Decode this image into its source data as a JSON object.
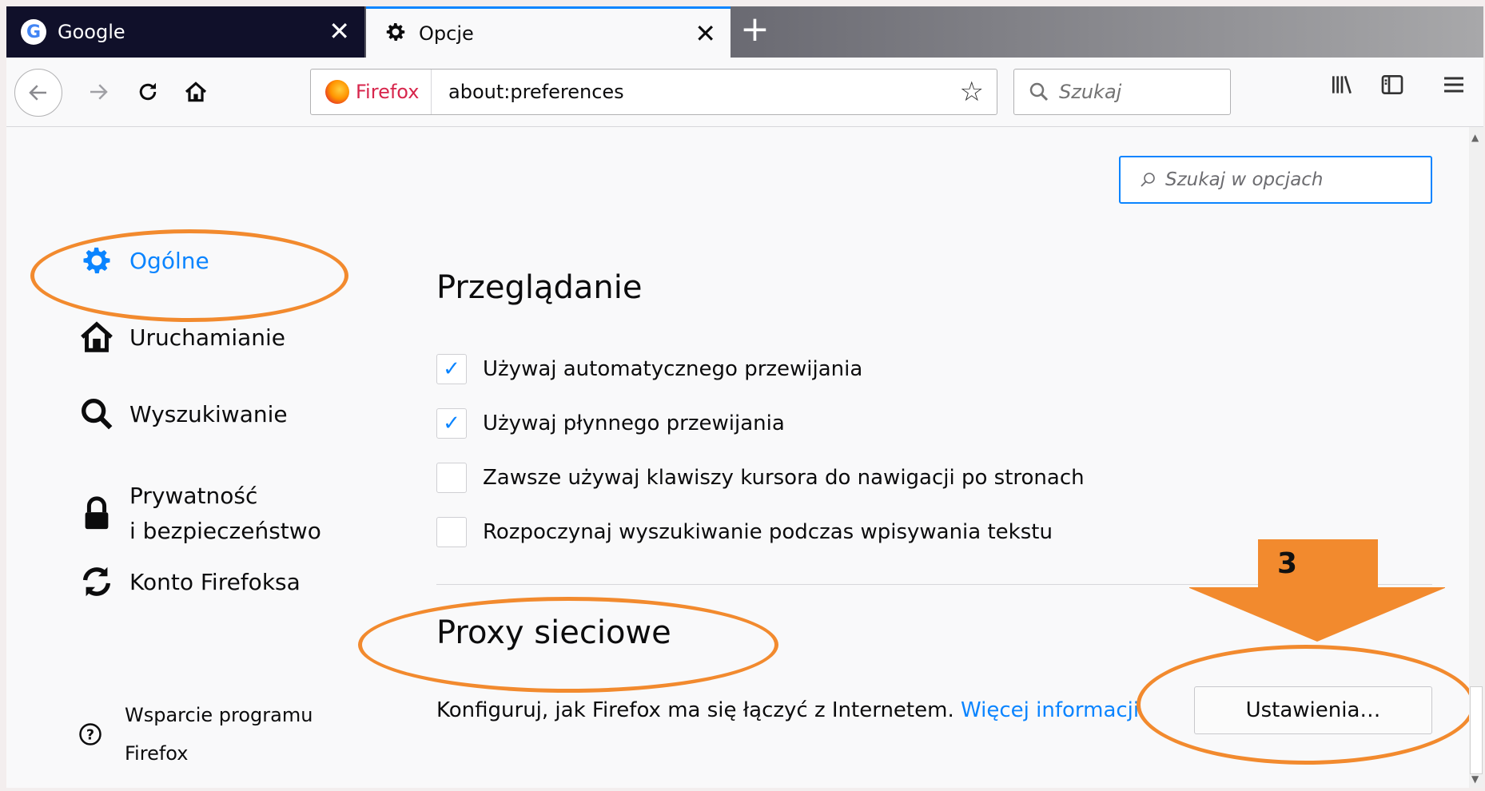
{
  "tabs": [
    {
      "title": "Google",
      "close": "✕"
    },
    {
      "title": "Opcje",
      "close": "✕"
    }
  ],
  "new_tab": "+",
  "navbar": {
    "identity_label": "Firefox",
    "url": "about:preferences",
    "search_placeholder": "Szukaj"
  },
  "prefs": {
    "search_placeholder": "Szukaj w opcjach",
    "categories": [
      {
        "label": "Ogólne",
        "icon": "gear-icon",
        "active": true
      },
      {
        "label": "Uruchamianie",
        "icon": "home-icon"
      },
      {
        "label": "Wyszukiwanie",
        "icon": "search-icon"
      },
      {
        "label": "Prywatność",
        "label2": "i bezpieczeństwo",
        "icon": "lock-icon"
      },
      {
        "label": "Konto Firefoksa",
        "icon": "sync-icon"
      }
    ],
    "support": {
      "line1": "Wsparcie programu",
      "line2": "Firefox",
      "icon": "help-icon"
    },
    "browsing": {
      "title": "Przeglądanie",
      "options": [
        {
          "label": "Używaj automatycznego przewijania",
          "checked": true
        },
        {
          "label": "Używaj płynnego przewijania",
          "checked": true
        },
        {
          "label": "Zawsze używaj klawiszy kursora do nawigacji po stronach",
          "checked": false
        },
        {
          "label": "Rozpoczynaj wyszukiwanie podczas wpisywania tekstu",
          "checked": false
        }
      ]
    },
    "proxy": {
      "title": "Proxy sieciowe",
      "description": "Konfiguruj, jak Firefox ma się łączyć z Internetem.",
      "link": "Więcej informacji",
      "button": "Ustawienia…"
    }
  },
  "annotation": {
    "step": "3",
    "color": "#f28a2e"
  },
  "colors": {
    "accent": "#0a84ff",
    "annotation": "#f28a2e"
  }
}
